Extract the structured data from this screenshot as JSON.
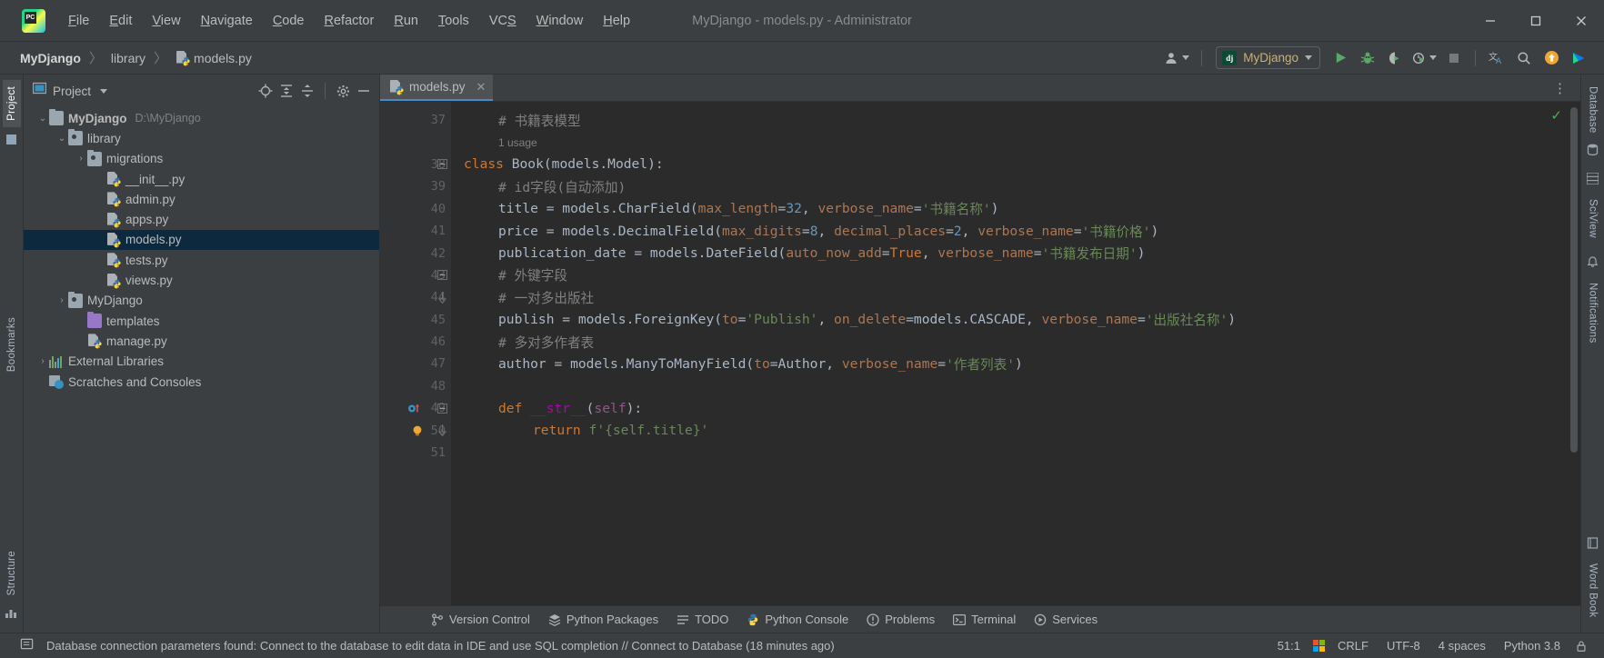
{
  "window": {
    "title": "MyDjango - models.py - Administrator",
    "logo_text": "PC",
    "minimize": "—",
    "maximize": "□",
    "close": "✕"
  },
  "menu": [
    {
      "label": "File",
      "mnemonic": "F",
      "rest": "ile"
    },
    {
      "label": "Edit",
      "mnemonic": "E",
      "rest": "dit"
    },
    {
      "label": "View",
      "mnemonic": "V",
      "rest": "iew"
    },
    {
      "label": "Navigate",
      "mnemonic": "N",
      "rest": "avigate"
    },
    {
      "label": "Code",
      "mnemonic": "C",
      "rest": "ode"
    },
    {
      "label": "Refactor",
      "mnemonic": "R",
      "rest": "efactor"
    },
    {
      "label": "Run",
      "mnemonic": "R",
      "rest": "un"
    },
    {
      "label": "Tools",
      "mnemonic": "T",
      "rest": "ools"
    },
    {
      "label": "VCS",
      "mnemonic": "S",
      "rest": "VC"
    },
    {
      "label": "Window",
      "mnemonic": "W",
      "rest": "indow"
    },
    {
      "label": "Help",
      "mnemonic": "H",
      "rest": "elp"
    }
  ],
  "navbar": {
    "breadcrumbs": [
      "MyDjango",
      "library",
      "models.py"
    ],
    "separator": "〉",
    "run_config": "MyDjango",
    "run_config_badge": "dj"
  },
  "left_rail": {
    "top": "Project",
    "bookmarks": "Bookmarks",
    "structure": "Structure"
  },
  "right_rail": {
    "database": "Database",
    "sciview": "SciView",
    "notifications": "Notifications",
    "word_book": "Word Book"
  },
  "project_panel": {
    "title": "Project",
    "tree": [
      {
        "label": "MyDjango",
        "path": "D:\\MyDjango",
        "indent": 0,
        "arrow": "⌄",
        "icon": "folder",
        "bold": true,
        "selected": false
      },
      {
        "label": "library",
        "path": "",
        "indent": 1,
        "arrow": "⌄",
        "icon": "folder-module",
        "bold": false,
        "selected": false
      },
      {
        "label": "migrations",
        "path": "",
        "indent": 2,
        "arrow": "›",
        "icon": "folder-module",
        "bold": false,
        "selected": false
      },
      {
        "label": "__init__.py",
        "path": "",
        "indent": 3,
        "arrow": "",
        "icon": "python",
        "bold": false,
        "selected": false
      },
      {
        "label": "admin.py",
        "path": "",
        "indent": 3,
        "arrow": "",
        "icon": "python",
        "bold": false,
        "selected": false
      },
      {
        "label": "apps.py",
        "path": "",
        "indent": 3,
        "arrow": "",
        "icon": "python",
        "bold": false,
        "selected": false
      },
      {
        "label": "models.py",
        "path": "",
        "indent": 3,
        "arrow": "",
        "icon": "python",
        "bold": false,
        "selected": true
      },
      {
        "label": "tests.py",
        "path": "",
        "indent": 3,
        "arrow": "",
        "icon": "python",
        "bold": false,
        "selected": false
      },
      {
        "label": "views.py",
        "path": "",
        "indent": 3,
        "arrow": "",
        "icon": "python",
        "bold": false,
        "selected": false
      },
      {
        "label": "MyDjango",
        "path": "",
        "indent": 1,
        "arrow": "›",
        "icon": "folder-module",
        "bold": false,
        "selected": false
      },
      {
        "label": "templates",
        "path": "",
        "indent": 2,
        "arrow": "",
        "icon": "folder-purple",
        "bold": false,
        "selected": false
      },
      {
        "label": "manage.py",
        "path": "",
        "indent": 2,
        "arrow": "",
        "icon": "python",
        "bold": false,
        "selected": false
      },
      {
        "label": "External Libraries",
        "path": "",
        "indent": 0,
        "arrow": "›",
        "icon": "library",
        "bold": false,
        "selected": false
      },
      {
        "label": "Scratches and Consoles",
        "path": "",
        "indent": 0,
        "arrow": "",
        "icon": "scratches",
        "bold": false,
        "selected": false
      }
    ]
  },
  "editor": {
    "tab_name": "models.py",
    "tab_close": "✕",
    "inspection_ok": "✓",
    "lines": [
      {
        "num": "37",
        "indent": 1,
        "fold": "",
        "gutter_icon": "",
        "tokens": [
          {
            "t": "# 书籍表模型",
            "c": "cmt"
          }
        ]
      },
      {
        "num": "",
        "indent": 1,
        "fold": "",
        "gutter_icon": "",
        "hint": true,
        "tokens": [
          {
            "t": "1 usage",
            "c": "cmt"
          }
        ]
      },
      {
        "num": "38",
        "indent": 0,
        "fold": "minus",
        "gutter_icon": "",
        "tokens": [
          {
            "t": "class ",
            "c": "kw"
          },
          {
            "t": "Book",
            "c": "cls"
          },
          {
            "t": "(models.Model):",
            "c": ""
          }
        ]
      },
      {
        "num": "39",
        "indent": 1,
        "fold": "",
        "gutter_icon": "",
        "tokens": [
          {
            "t": "# id字段(自动添加)",
            "c": "cmt"
          }
        ]
      },
      {
        "num": "40",
        "indent": 1,
        "fold": "",
        "gutter_icon": "",
        "tokens": [
          {
            "t": "title = models.CharField(",
            "c": ""
          },
          {
            "t": "max_length",
            "c": "kwarg"
          },
          {
            "t": "=",
            "c": ""
          },
          {
            "t": "32",
            "c": "num"
          },
          {
            "t": ", ",
            "c": ""
          },
          {
            "t": "verbose_name",
            "c": "kwarg"
          },
          {
            "t": "=",
            "c": ""
          },
          {
            "t": "'书籍名称'",
            "c": "str"
          },
          {
            "t": ")",
            "c": ""
          }
        ]
      },
      {
        "num": "41",
        "indent": 1,
        "fold": "",
        "gutter_icon": "",
        "tokens": [
          {
            "t": "price = models.DecimalField(",
            "c": ""
          },
          {
            "t": "max_digits",
            "c": "kwarg"
          },
          {
            "t": "=",
            "c": ""
          },
          {
            "t": "8",
            "c": "num"
          },
          {
            "t": ", ",
            "c": ""
          },
          {
            "t": "decimal_places",
            "c": "kwarg"
          },
          {
            "t": "=",
            "c": ""
          },
          {
            "t": "2",
            "c": "num"
          },
          {
            "t": ", ",
            "c": ""
          },
          {
            "t": "verbose_name",
            "c": "kwarg"
          },
          {
            "t": "=",
            "c": ""
          },
          {
            "t": "'书籍价格'",
            "c": "str"
          },
          {
            "t": ")",
            "c": ""
          }
        ]
      },
      {
        "num": "42",
        "indent": 1,
        "fold": "",
        "gutter_icon": "",
        "tokens": [
          {
            "t": "publication_date = models.DateField(",
            "c": ""
          },
          {
            "t": "auto_now_add",
            "c": "kwarg"
          },
          {
            "t": "=",
            "c": ""
          },
          {
            "t": "True",
            "c": "kw"
          },
          {
            "t": ", ",
            "c": ""
          },
          {
            "t": "verbose_name",
            "c": "kwarg"
          },
          {
            "t": "=",
            "c": ""
          },
          {
            "t": "'书籍发布日期'",
            "c": "str"
          },
          {
            "t": ")",
            "c": ""
          }
        ]
      },
      {
        "num": "43",
        "indent": 1,
        "fold": "minus",
        "gutter_icon": "",
        "tokens": [
          {
            "t": "# 外键字段",
            "c": "cmt"
          }
        ]
      },
      {
        "num": "44",
        "indent": 1,
        "fold": "end",
        "gutter_icon": "",
        "tokens": [
          {
            "t": "# 一对多出版社",
            "c": "cmt"
          }
        ]
      },
      {
        "num": "45",
        "indent": 1,
        "fold": "",
        "gutter_icon": "",
        "tokens": [
          {
            "t": "publish = models.ForeignKey(",
            "c": ""
          },
          {
            "t": "to",
            "c": "kwarg"
          },
          {
            "t": "=",
            "c": ""
          },
          {
            "t": "'Publish'",
            "c": "str"
          },
          {
            "t": ", ",
            "c": ""
          },
          {
            "t": "on_delete",
            "c": "kwarg"
          },
          {
            "t": "=models.CASCADE, ",
            "c": ""
          },
          {
            "t": "verbose_name",
            "c": "kwarg"
          },
          {
            "t": "=",
            "c": ""
          },
          {
            "t": "'出版社名称'",
            "c": "str"
          },
          {
            "t": ")",
            "c": ""
          }
        ]
      },
      {
        "num": "46",
        "indent": 1,
        "fold": "",
        "gutter_icon": "",
        "tokens": [
          {
            "t": "# 多对多作者表",
            "c": "cmt"
          }
        ]
      },
      {
        "num": "47",
        "indent": 1,
        "fold": "",
        "gutter_icon": "",
        "tokens": [
          {
            "t": "author = models.ManyToManyField(",
            "c": ""
          },
          {
            "t": "to",
            "c": "kwarg"
          },
          {
            "t": "=Author, ",
            "c": ""
          },
          {
            "t": "verbose_name",
            "c": "kwarg"
          },
          {
            "t": "=",
            "c": ""
          },
          {
            "t": "'作者列表'",
            "c": "str"
          },
          {
            "t": ")",
            "c": ""
          }
        ]
      },
      {
        "num": "48",
        "indent": 0,
        "fold": "",
        "gutter_icon": "",
        "tokens": []
      },
      {
        "num": "49",
        "indent": 1,
        "fold": "minus",
        "gutter_icon": "override",
        "tokens": [
          {
            "t": "def ",
            "c": "kw"
          },
          {
            "t": "__str__",
            "c": "magic"
          },
          {
            "t": "(",
            "c": ""
          },
          {
            "t": "self",
            "c": "self"
          },
          {
            "t": "):",
            "c": ""
          }
        ]
      },
      {
        "num": "50",
        "indent": 2,
        "fold": "end",
        "gutter_icon": "bulb",
        "tokens": [
          {
            "t": "return ",
            "c": "kw"
          },
          {
            "t": "f",
            "c": "str"
          },
          {
            "t": "'{self.title}'",
            "c": "str"
          }
        ]
      },
      {
        "num": "51",
        "indent": 0,
        "fold": "",
        "gutter_icon": "",
        "tokens": []
      }
    ]
  },
  "bottom_tabs": [
    {
      "label": "Version Control",
      "icon": "branch-icon"
    },
    {
      "label": "Python Packages",
      "icon": "packages-icon"
    },
    {
      "label": "TODO",
      "icon": "todo-icon"
    },
    {
      "label": "Python Console",
      "icon": "console-icon"
    },
    {
      "label": "Problems",
      "icon": "problems-icon"
    },
    {
      "label": "Terminal",
      "icon": "terminal-icon"
    },
    {
      "label": "Services",
      "icon": "services-icon"
    }
  ],
  "statusbar": {
    "message": "Database connection parameters found: Connect to the database to edit data in IDE and use SQL completion // Connect to Database (18 minutes ago)",
    "caret": "51:1",
    "line_sep": "CRLF",
    "encoding": "UTF-8",
    "indent": "4 spaces",
    "interpreter": "Python 3.8"
  },
  "colors": {
    "bg": "#3c3f41",
    "editor_bg": "#2b2b2b",
    "gutter_bg": "#313335",
    "selection": "#0d293e",
    "accent_blue": "#4a88c7",
    "keyword": "#cc7832",
    "string": "#6a8759",
    "number": "#6897bb",
    "comment": "#808080",
    "kwarg": "#aa7755",
    "magic": "#b200b2",
    "green_run": "#59a869",
    "orange": "#f0a732"
  }
}
